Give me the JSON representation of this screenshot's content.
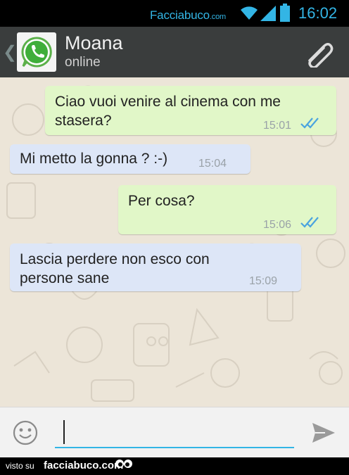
{
  "status_bar": {
    "brand": "Facciabuco",
    "brand_suffix": ".com",
    "time": "16:02",
    "accent_color": "#33b5e5",
    "icons": [
      "wifi-icon",
      "signal-icon",
      "battery-icon"
    ]
  },
  "header": {
    "contact_name": "Moana",
    "contact_status": "online",
    "icons": [
      "back-chevron-icon",
      "whatsapp-logo-icon",
      "paperclip-icon"
    ]
  },
  "messages": [
    {
      "direction": "outgoing",
      "lines": [
        "Ciao vuoi venire al cinema con me",
        "stasera?"
      ],
      "time": "15:01",
      "read": true
    },
    {
      "direction": "incoming",
      "lines": [
        "Mi metto la gonna ? :-)"
      ],
      "time": "15:04"
    },
    {
      "direction": "outgoing",
      "lines": [
        "Per cosa?"
      ],
      "time": "15:06",
      "read": true
    },
    {
      "direction": "incoming",
      "lines": [
        "Lascia perdere non esco con",
        "persone sane"
      ],
      "time": "15:09"
    }
  ],
  "input_bar": {
    "value": "",
    "icons": [
      "smiley-icon",
      "send-icon"
    ]
  },
  "footer": {
    "visto_label": "visto su",
    "site": "facciabuco.com"
  },
  "colors": {
    "outgoing_bubble": "#e1f7c8",
    "incoming_bubble": "#dde6f7",
    "chat_background": "#ece5d8",
    "header_background": "#3a3d3d",
    "read_ticks": "#4aa3df"
  }
}
